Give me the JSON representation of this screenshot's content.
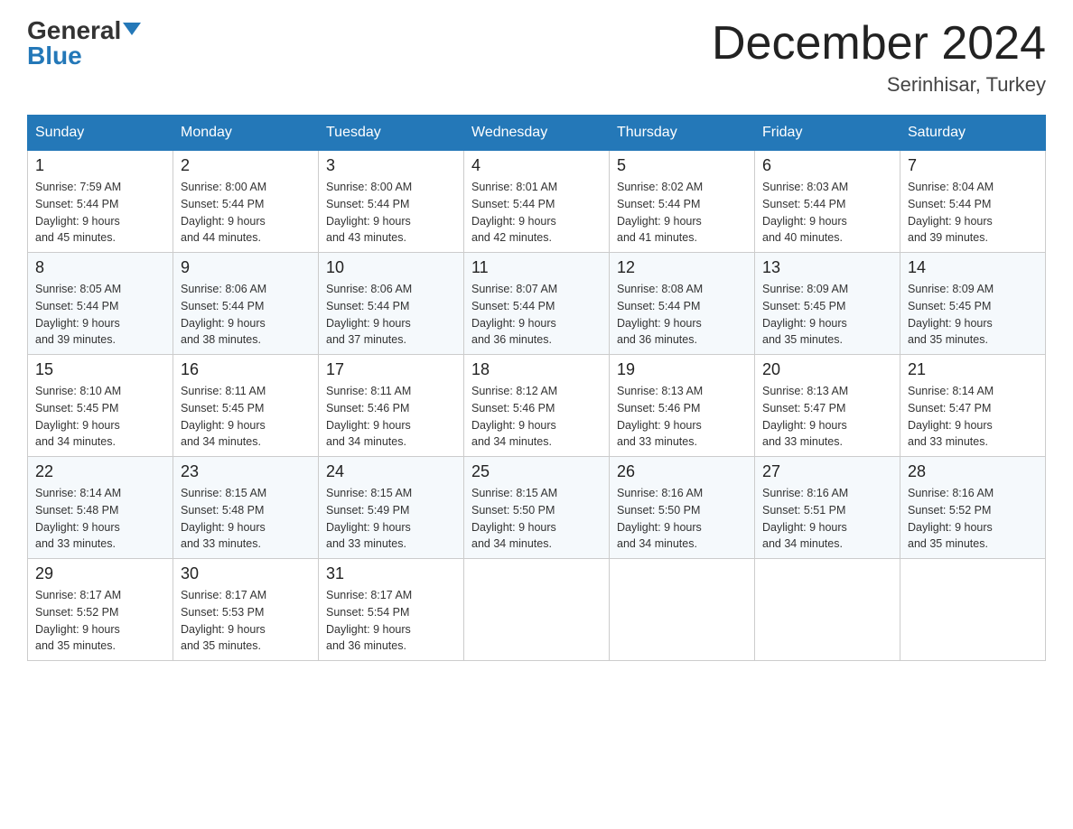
{
  "header": {
    "logo_general": "General",
    "logo_blue": "Blue",
    "title": "December 2024",
    "subtitle": "Serinhisar, Turkey"
  },
  "days_of_week": [
    "Sunday",
    "Monday",
    "Tuesday",
    "Wednesday",
    "Thursday",
    "Friday",
    "Saturday"
  ],
  "weeks": [
    [
      {
        "day": "1",
        "sunrise": "7:59 AM",
        "sunset": "5:44 PM",
        "daylight": "9 hours and 45 minutes."
      },
      {
        "day": "2",
        "sunrise": "8:00 AM",
        "sunset": "5:44 PM",
        "daylight": "9 hours and 44 minutes."
      },
      {
        "day": "3",
        "sunrise": "8:00 AM",
        "sunset": "5:44 PM",
        "daylight": "9 hours and 43 minutes."
      },
      {
        "day": "4",
        "sunrise": "8:01 AM",
        "sunset": "5:44 PM",
        "daylight": "9 hours and 42 minutes."
      },
      {
        "day": "5",
        "sunrise": "8:02 AM",
        "sunset": "5:44 PM",
        "daylight": "9 hours and 41 minutes."
      },
      {
        "day": "6",
        "sunrise": "8:03 AM",
        "sunset": "5:44 PM",
        "daylight": "9 hours and 40 minutes."
      },
      {
        "day": "7",
        "sunrise": "8:04 AM",
        "sunset": "5:44 PM",
        "daylight": "9 hours and 39 minutes."
      }
    ],
    [
      {
        "day": "8",
        "sunrise": "8:05 AM",
        "sunset": "5:44 PM",
        "daylight": "9 hours and 39 minutes."
      },
      {
        "day": "9",
        "sunrise": "8:06 AM",
        "sunset": "5:44 PM",
        "daylight": "9 hours and 38 minutes."
      },
      {
        "day": "10",
        "sunrise": "8:06 AM",
        "sunset": "5:44 PM",
        "daylight": "9 hours and 37 minutes."
      },
      {
        "day": "11",
        "sunrise": "8:07 AM",
        "sunset": "5:44 PM",
        "daylight": "9 hours and 36 minutes."
      },
      {
        "day": "12",
        "sunrise": "8:08 AM",
        "sunset": "5:44 PM",
        "daylight": "9 hours and 36 minutes."
      },
      {
        "day": "13",
        "sunrise": "8:09 AM",
        "sunset": "5:45 PM",
        "daylight": "9 hours and 35 minutes."
      },
      {
        "day": "14",
        "sunrise": "8:09 AM",
        "sunset": "5:45 PM",
        "daylight": "9 hours and 35 minutes."
      }
    ],
    [
      {
        "day": "15",
        "sunrise": "8:10 AM",
        "sunset": "5:45 PM",
        "daylight": "9 hours and 34 minutes."
      },
      {
        "day": "16",
        "sunrise": "8:11 AM",
        "sunset": "5:45 PM",
        "daylight": "9 hours and 34 minutes."
      },
      {
        "day": "17",
        "sunrise": "8:11 AM",
        "sunset": "5:46 PM",
        "daylight": "9 hours and 34 minutes."
      },
      {
        "day": "18",
        "sunrise": "8:12 AM",
        "sunset": "5:46 PM",
        "daylight": "9 hours and 34 minutes."
      },
      {
        "day": "19",
        "sunrise": "8:13 AM",
        "sunset": "5:46 PM",
        "daylight": "9 hours and 33 minutes."
      },
      {
        "day": "20",
        "sunrise": "8:13 AM",
        "sunset": "5:47 PM",
        "daylight": "9 hours and 33 minutes."
      },
      {
        "day": "21",
        "sunrise": "8:14 AM",
        "sunset": "5:47 PM",
        "daylight": "9 hours and 33 minutes."
      }
    ],
    [
      {
        "day": "22",
        "sunrise": "8:14 AM",
        "sunset": "5:48 PM",
        "daylight": "9 hours and 33 minutes."
      },
      {
        "day": "23",
        "sunrise": "8:15 AM",
        "sunset": "5:48 PM",
        "daylight": "9 hours and 33 minutes."
      },
      {
        "day": "24",
        "sunrise": "8:15 AM",
        "sunset": "5:49 PM",
        "daylight": "9 hours and 33 minutes."
      },
      {
        "day": "25",
        "sunrise": "8:15 AM",
        "sunset": "5:50 PM",
        "daylight": "9 hours and 34 minutes."
      },
      {
        "day": "26",
        "sunrise": "8:16 AM",
        "sunset": "5:50 PM",
        "daylight": "9 hours and 34 minutes."
      },
      {
        "day": "27",
        "sunrise": "8:16 AM",
        "sunset": "5:51 PM",
        "daylight": "9 hours and 34 minutes."
      },
      {
        "day": "28",
        "sunrise": "8:16 AM",
        "sunset": "5:52 PM",
        "daylight": "9 hours and 35 minutes."
      }
    ],
    [
      {
        "day": "29",
        "sunrise": "8:17 AM",
        "sunset": "5:52 PM",
        "daylight": "9 hours and 35 minutes."
      },
      {
        "day": "30",
        "sunrise": "8:17 AM",
        "sunset": "5:53 PM",
        "daylight": "9 hours and 35 minutes."
      },
      {
        "day": "31",
        "sunrise": "8:17 AM",
        "sunset": "5:54 PM",
        "daylight": "9 hours and 36 minutes."
      },
      null,
      null,
      null,
      null
    ]
  ],
  "labels": {
    "sunrise_prefix": "Sunrise: ",
    "sunset_prefix": "Sunset: ",
    "daylight_prefix": "Daylight: "
  }
}
